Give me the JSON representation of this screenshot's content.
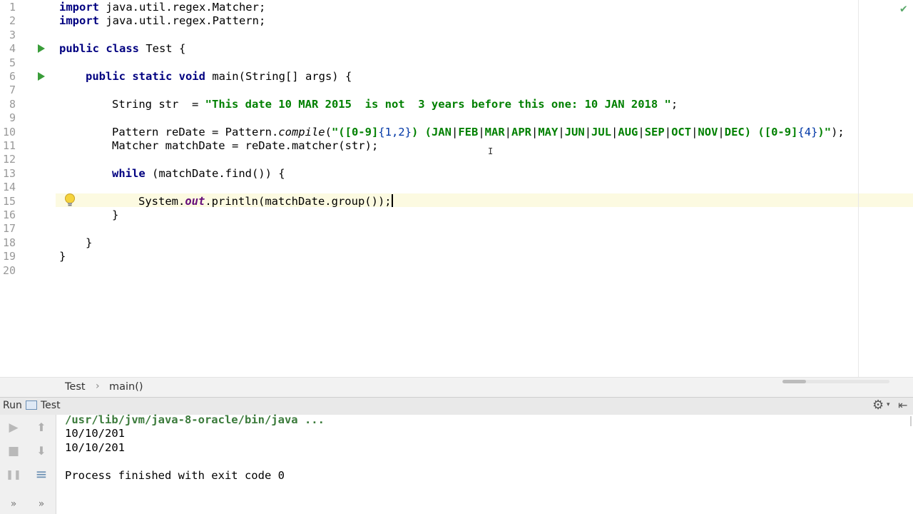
{
  "editor": {
    "line_numbers": [
      "1",
      "2",
      "3",
      "4",
      "5",
      "6",
      "7",
      "8",
      "9",
      "10",
      "11",
      "12",
      "13",
      "14",
      "15",
      "16",
      "17",
      "18",
      "19",
      "20"
    ],
    "line1": {
      "kw": "import",
      "rest": " java.util.regex.Matcher;"
    },
    "line2": {
      "kw": "import",
      "rest": " java.util.regex.Pattern;"
    },
    "line4": {
      "kw": "public class",
      "rest": " Test {"
    },
    "line6": {
      "kw": "public static void",
      "rest": " main(String[] args) {"
    },
    "line8": {
      "a": "String str  = ",
      "str": "\"This date 10 MAR 2015  is not  3 years before this one: 10 JAN 2018 \"",
      "b": ";"
    },
    "line10": {
      "a": "Pattern reDate = Pattern.",
      "method": "compile",
      "b": "(",
      "s1": "\"([0-9]",
      "e1": "{1,2}",
      "s2": ") (JAN",
      "months": [
        "FEB",
        "MAR",
        "APR",
        "MAY",
        "JUN",
        "JUL",
        "AUG",
        "SEP",
        "OCT",
        "NOV",
        "DEC"
      ],
      "s3": ") ([0-9]",
      "e2": "{4}",
      "s4": ")\"",
      "c": ");",
      "pipe": "|"
    },
    "line11": {
      "code": "Matcher matchDate = reDate.matcher(str);"
    },
    "line13": {
      "kw": "while",
      "rest": " (matchDate.find()) {"
    },
    "line15": {
      "a": "System.",
      "field": "out",
      "b": ".println(matchDate.group());"
    },
    "line16": {
      "code": "}"
    },
    "line18": {
      "code": "}"
    },
    "line19": {
      "code": "}"
    }
  },
  "breadcrumb": {
    "class": "Test",
    "separator": "›",
    "method": "main()"
  },
  "run_window": {
    "title": "Run",
    "tab_label": "Test",
    "gear_icon": "⚙",
    "gear_caret": "▾",
    "hide_icon": "⇤"
  },
  "toolbar": {
    "rerun": "▶",
    "up": "⬆",
    "stop": "■",
    "down": "⬇",
    "pause": "❚❚",
    "wrap": "≡",
    "more_left": "»",
    "more_right": "»"
  },
  "console": {
    "command": "/usr/lib/jvm/java-8-oracle/bin/java ...",
    "output": [
      "10/10/201",
      "10/10/201"
    ],
    "finish": "Process finished with exit code 0"
  },
  "colors": {
    "keyword": "#000080",
    "string": "#008000",
    "field": "#660e7a",
    "current_line": "#fcfae1"
  }
}
